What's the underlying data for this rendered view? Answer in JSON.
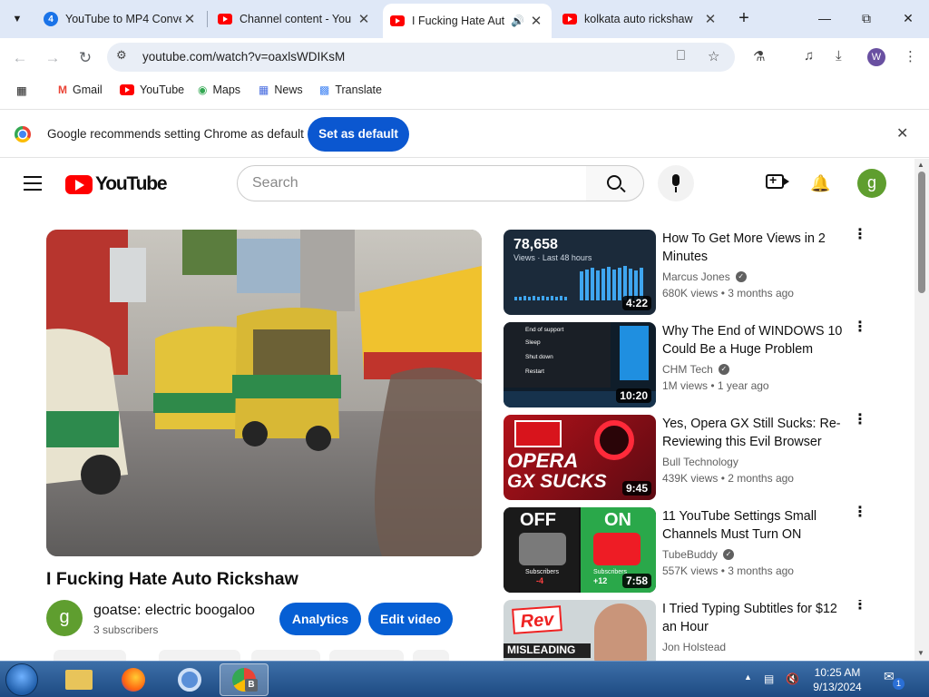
{
  "browser": {
    "tabs": [
      {
        "title": "YouTube to MP4 Conve",
        "favicon": "numbered-4-icon",
        "favicon_text": "4"
      },
      {
        "title": "Channel content - You",
        "favicon": "youtube-icon"
      },
      {
        "title": "I Fucking Hate Aut",
        "favicon": "youtube-icon",
        "active": true,
        "audio": true
      },
      {
        "title": "kolkata auto rickshaw",
        "favicon": "youtube-icon"
      }
    ],
    "url": "youtube.com/watch?v=oaxlsWDIKsM",
    "profile_initial": "W",
    "bookmarks": [
      {
        "label": "Gmail",
        "icon": "gmail-icon"
      },
      {
        "label": "YouTube",
        "icon": "youtube-icon"
      },
      {
        "label": "Maps",
        "icon": "maps-icon"
      },
      {
        "label": "News",
        "icon": "news-icon"
      },
      {
        "label": "Translate",
        "icon": "translate-icon"
      }
    ],
    "infobar": {
      "text": "Google recommends setting Chrome as default",
      "button": "Set as default"
    }
  },
  "youtube": {
    "logo_text": "YouTube",
    "search_placeholder": "Search",
    "user_initial": "g",
    "video": {
      "title": "I Fucking Hate Auto Rickshaw",
      "channel": "goatse: electric boogaloo",
      "channel_initial": "g",
      "subscribers": "3 subscribers",
      "analytics_label": "Analytics",
      "edit_label": "Edit video"
    },
    "recommendations": [
      {
        "title": "How To Get More Views in 2 Minutes",
        "channel": "Marcus Jones",
        "verified": true,
        "views": "680K views",
        "age": "3 months ago",
        "duration": "4:22",
        "thumb_big": "78,658",
        "thumb_small": "Views · Last 48 hours"
      },
      {
        "title": "Why The End of WINDOWS 10 Could Be a Huge Problem",
        "channel": "CHM Tech",
        "verified": true,
        "views": "1M views",
        "age": "1 year ago",
        "duration": "10:20",
        "thumb_menu": [
          "End of support",
          "Sleep",
          "Shut down",
          "Restart"
        ]
      },
      {
        "title": "Yes, Opera GX Still Sucks: Re-Reviewing this Evil Browser",
        "channel": "Bull Technology",
        "verified": false,
        "views": "439K views",
        "age": "2 months ago",
        "duration": "9:45",
        "thumb_line1": "OPERA",
        "thumb_line2": "GX SUCKS"
      },
      {
        "title": "11 YouTube Settings Small Channels Must Turn ON",
        "channel": "TubeBuddy",
        "verified": true,
        "views": "557K views",
        "age": "3 months ago",
        "duration": "7:58",
        "thumb_off": "OFF",
        "thumb_on": "ON",
        "thumb_sub_label": "Subscribers",
        "thumb_sub_off": "-4",
        "thumb_sub_on": "+12"
      },
      {
        "title": "I Tried Typing Subtitles for $12 an Hour",
        "channel": "Jon Holstead",
        "verified": false,
        "views": "",
        "age": "",
        "duration": "",
        "thumb_brand": "Rev",
        "thumb_caption": "MISLEADING"
      }
    ]
  },
  "taskbar": {
    "time": "10:25 AM",
    "date": "9/13/2024",
    "notification_count": "1",
    "active_app_badge": "B"
  },
  "colors": {
    "tabstrip": "#dfe8f7",
    "chrome_blue": "#0b57d0",
    "yt_red": "#ff0000",
    "yt_blue": "#065fd4",
    "taskbar": "#1d4a82"
  }
}
